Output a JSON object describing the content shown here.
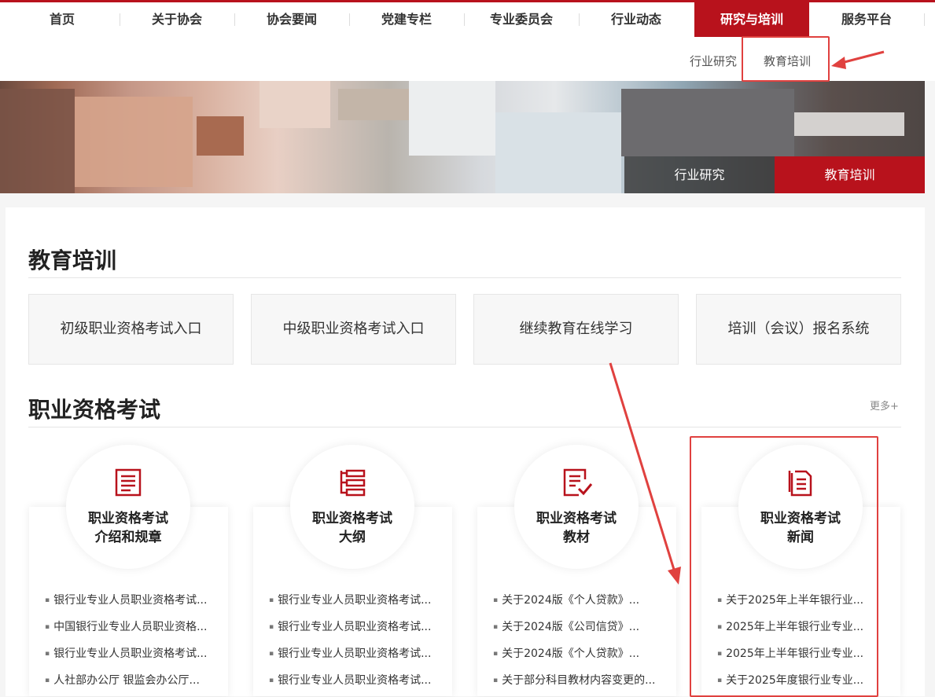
{
  "nav": {
    "items": [
      {
        "label": "首页"
      },
      {
        "label": "关于协会"
      },
      {
        "label": "协会要闻"
      },
      {
        "label": "党建专栏"
      },
      {
        "label": "专业委员会"
      },
      {
        "label": "行业动态"
      },
      {
        "label": "研究与培训"
      },
      {
        "label": "服务平台"
      }
    ]
  },
  "subnav": {
    "items": [
      {
        "label": "行业研究"
      },
      {
        "label": "教育培训"
      }
    ]
  },
  "banner": {
    "tabs": [
      {
        "label": "行业研究"
      },
      {
        "label": "教育培训"
      }
    ]
  },
  "education": {
    "title": "教育培训",
    "entries": [
      {
        "label": "初级职业资格考试入口"
      },
      {
        "label": "中级职业资格考试入口"
      },
      {
        "label": "继续教育在线学习"
      },
      {
        "label": "培训（会议）报名系统"
      }
    ]
  },
  "exam": {
    "title": "职业资格考试",
    "more": "更多+",
    "columns": [
      {
        "title_line1": "职业资格考试",
        "title_line2": "介绍和规章",
        "icon": "document-list-icon",
        "items": [
          "银行业专业人员职业资格考试...",
          "中国银行业专业人员职业资格...",
          "银行业专业人员职业资格考试...",
          "人社部办公厅 银监会办公厅..."
        ]
      },
      {
        "title_line1": "职业资格考试",
        "title_line2": "大纲",
        "icon": "outline-tree-icon",
        "items": [
          "银行业专业人员职业资格考试...",
          "银行业专业人员职业资格考试...",
          "银行业专业人员职业资格考试...",
          "银行业专业人员职业资格考试..."
        ]
      },
      {
        "title_line1": "职业资格考试",
        "title_line2": "教材",
        "icon": "checklist-icon",
        "items": [
          "关于2024版《个人贷款》...",
          "关于2024版《公司信贷》...",
          "关于2024版《个人贷款》...",
          "关于部分科目教材内容变更的..."
        ]
      },
      {
        "title_line1": "职业资格考试",
        "title_line2": "新闻",
        "icon": "news-document-icon",
        "items": [
          "关于2025年上半年银行业...",
          "2025年上半年银行业专业...",
          "2025年上半年银行业专业...",
          "关于2025年度银行业专业..."
        ]
      }
    ]
  },
  "colors": {
    "brand_red": "#b8121c",
    "annotation_red": "#e0413f"
  }
}
